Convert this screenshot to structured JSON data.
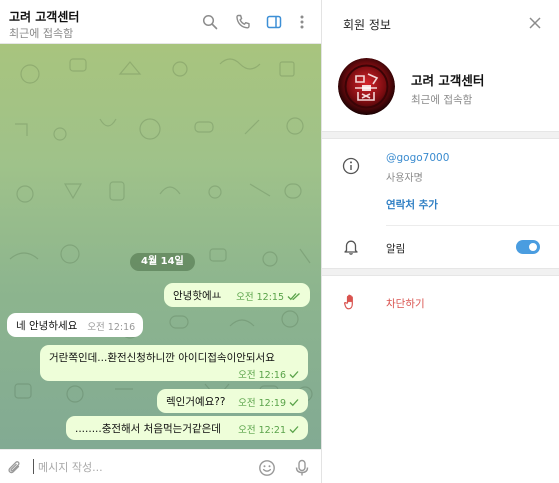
{
  "chat": {
    "title": "고려 고객센터",
    "status": "최근에 접속함",
    "date_divider": "4월 14일",
    "messages": [
      {
        "dir": "out",
        "text": "안녕핫에ㅛ",
        "time": "오전 12:15",
        "ticks": "double"
      },
      {
        "dir": "in",
        "text": "네 안녕하세요",
        "time": "오전 12:16"
      },
      {
        "dir": "out",
        "text": "거란쪽인데...환전신청하니깐 아이디접속이안되서요",
        "time": "오전 12:16",
        "ticks": "single"
      },
      {
        "dir": "out",
        "text": "렉인거예요??",
        "time": "오전 12:19",
        "ticks": "single"
      },
      {
        "dir": "out",
        "text": "........충전해서 처음먹는거같은데",
        "time": "오전 12:21",
        "ticks": "single"
      }
    ],
    "composer_placeholder": "메시지 작성..."
  },
  "header_icons": [
    "search-icon",
    "phone-icon",
    "sidebar-toggle-icon",
    "more-vertical-icon"
  ],
  "composer_icons": [
    "attach-icon",
    "emoji-icon",
    "microphone-icon"
  ],
  "panel": {
    "title": "회원 정보",
    "name": "고려 고객센터",
    "status": "최근에 접속함",
    "username": "@gogo7000",
    "username_label": "사용자명",
    "add_contact": "연락처 추가",
    "notifications_label": "알림",
    "notifications_on": true,
    "block_label": "차단하기"
  },
  "colors": {
    "accent": "#4a9de0",
    "outgoing_bubble": "#eefed9",
    "danger": "#d9534f",
    "check": "#5aa34a"
  }
}
